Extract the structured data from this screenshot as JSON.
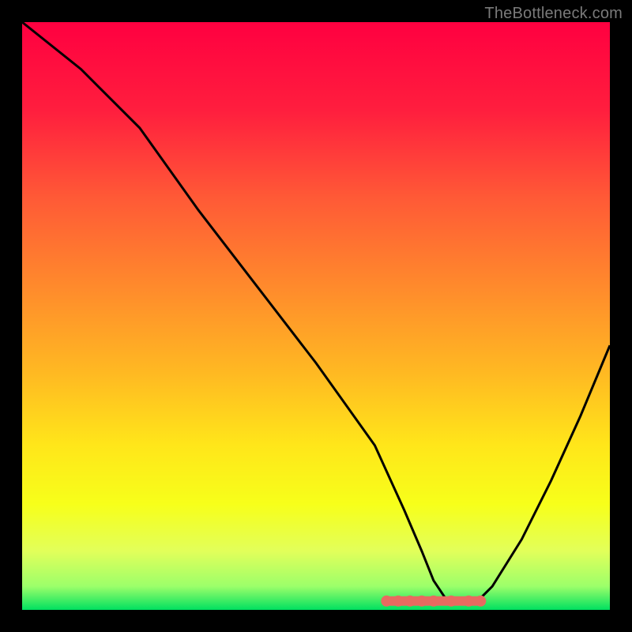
{
  "watermark": "TheBottleneck.com",
  "chart_data": {
    "type": "line",
    "title": "",
    "xlabel": "",
    "ylabel": "",
    "xlim": [
      0,
      100
    ],
    "ylim": [
      0,
      100
    ],
    "x": [
      0,
      10,
      20,
      30,
      40,
      50,
      60,
      65,
      68,
      70,
      72,
      74,
      76,
      78,
      80,
      85,
      90,
      95,
      100
    ],
    "values": [
      100,
      92,
      82,
      68,
      55,
      42,
      28,
      17,
      10,
      5,
      2,
      1,
      1,
      2,
      4,
      12,
      22,
      33,
      45
    ],
    "gradient_stops": [
      {
        "offset": 0.0,
        "color": "#ff0040"
      },
      {
        "offset": 0.15,
        "color": "#ff1e3e"
      },
      {
        "offset": 0.3,
        "color": "#ff5a36"
      },
      {
        "offset": 0.45,
        "color": "#ff8a2c"
      },
      {
        "offset": 0.6,
        "color": "#ffba22"
      },
      {
        "offset": 0.72,
        "color": "#ffe61a"
      },
      {
        "offset": 0.82,
        "color": "#f7ff1a"
      },
      {
        "offset": 0.9,
        "color": "#e2ff5a"
      },
      {
        "offset": 0.96,
        "color": "#9cff6a"
      },
      {
        "offset": 1.0,
        "color": "#00e060"
      }
    ],
    "markers": {
      "color": "#e86a60",
      "x": [
        62,
        64,
        66,
        68,
        70,
        73,
        76,
        78
      ],
      "y": [
        1.5,
        1.5,
        1.5,
        1.5,
        1.5,
        1.5,
        1.5,
        1.5
      ]
    }
  }
}
